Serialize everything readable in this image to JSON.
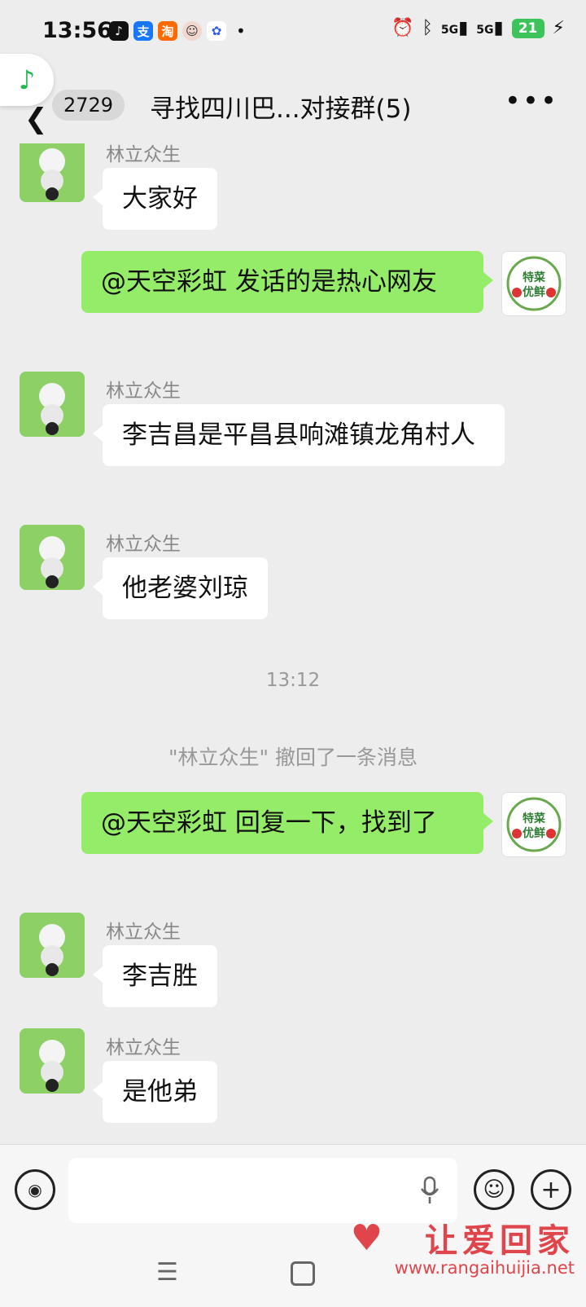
{
  "status_bar": {
    "time": "13:56",
    "notification_icons": [
      "tiktok-icon",
      "alipay-icon",
      "taobao-icon",
      "avatar-icon",
      "baidu-icon"
    ],
    "signal_1": "5G",
    "signal_2": "5G",
    "battery": "21"
  },
  "header": {
    "unread_count": "2729",
    "title": "寻找四川巴...对接群(5)"
  },
  "messages": [
    {
      "side": "left",
      "sender": "林立众生",
      "text": "大家好"
    },
    {
      "side": "right",
      "text": "@天空彩虹  发话的是热心网友"
    },
    {
      "side": "left",
      "sender": "林立众生",
      "text": "李吉昌是平昌县响滩镇龙角村人"
    },
    {
      "side": "left",
      "sender": "林立众生",
      "text": "他老婆刘琼"
    },
    {
      "type": "time",
      "text": "13:12"
    },
    {
      "type": "system",
      "text": "\"林立众生\" 撤回了一条消息"
    },
    {
      "side": "right",
      "text": "@天空彩虹  回复一下，找到了"
    },
    {
      "side": "left",
      "sender": "林立众生",
      "text": "李吉胜"
    },
    {
      "side": "left",
      "sender": "林立众生",
      "text": "是他弟"
    }
  ],
  "self_avatar_text": "特菜优鲜",
  "watermark": {
    "title": "让爱回家",
    "url": "www.rangaihuijia.net"
  },
  "colors": {
    "self_bubble": "#95ec69",
    "other_bubble": "#ffffff",
    "background": "#ededed",
    "watermark": "#e0454b"
  }
}
